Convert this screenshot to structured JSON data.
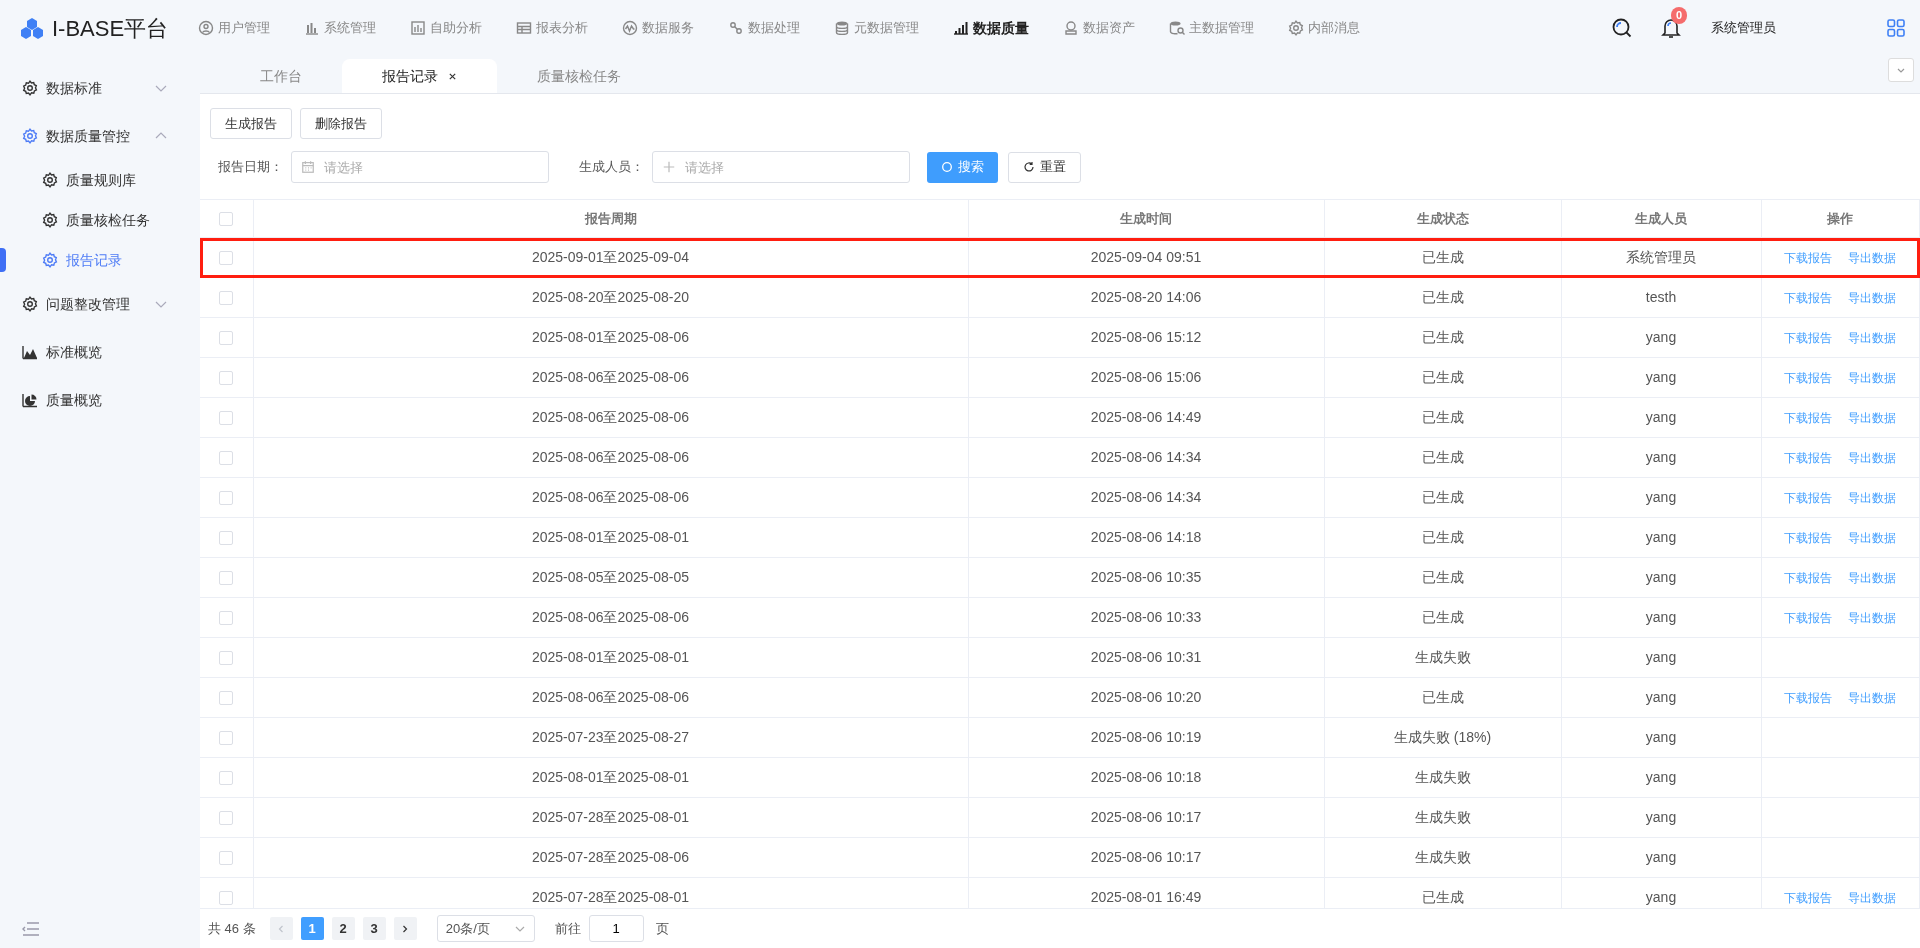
{
  "brand": {
    "title": "I-BASE平台"
  },
  "nav": [
    {
      "label": "用户管理",
      "selected": false
    },
    {
      "label": "系统管理",
      "selected": false
    },
    {
      "label": "自助分析",
      "selected": false
    },
    {
      "label": "报表分析",
      "selected": false
    },
    {
      "label": "数据服务",
      "selected": false
    },
    {
      "label": "数据处理",
      "selected": false
    },
    {
      "label": "元数据管理",
      "selected": false
    },
    {
      "label": "数据质量",
      "selected": true
    },
    {
      "label": "数据资产",
      "selected": false
    },
    {
      "label": "主数据管理",
      "selected": false
    },
    {
      "label": "内部消息",
      "selected": false
    }
  ],
  "header_right": {
    "notification_count": "0",
    "user": "系统管理员"
  },
  "tabs": [
    {
      "label": "工作台",
      "selected": false,
      "closable": false
    },
    {
      "label": "报告记录",
      "selected": true,
      "closable": true
    },
    {
      "label": "质量核检任务",
      "selected": false,
      "closable": false
    }
  ],
  "sidebar": {
    "items": [
      {
        "label": "数据标准",
        "expanded": false,
        "selected": false
      },
      {
        "label": "数据质量管控",
        "expanded": true,
        "selected": false,
        "children": [
          {
            "label": "质量规则库",
            "selected": false
          },
          {
            "label": "质量核检任务",
            "selected": false
          },
          {
            "label": "报告记录",
            "selected": true
          }
        ]
      },
      {
        "label": "问题整改管理",
        "expanded": false,
        "selected": false
      },
      {
        "label": "标准概览",
        "selected": false
      },
      {
        "label": "质量概览",
        "selected": false
      }
    ]
  },
  "toolbar": [
    "生成报告",
    "删除报告"
  ],
  "filters": [
    {
      "label": "报告日期：",
      "placeholder": "请选择"
    },
    {
      "label": "生成人员：",
      "placeholder": "请选择"
    }
  ],
  "search_button": "搜索",
  "reset_button": "重置",
  "table": {
    "select_all_checked": false,
    "columns": [
      "报告周期",
      "生成时间",
      "生成状态",
      "生成人员",
      "操作"
    ],
    "rows": [
      {
        "checked": false,
        "highlighted": true,
        "period": "2025-09-01至2025-09-04",
        "time": "2025-09-04 09:51",
        "status": "已生成",
        "user": "系统管理员",
        "actions": [
          "下载报告",
          "导出数据"
        ]
      },
      {
        "checked": false,
        "highlighted": false,
        "period": "2025-08-20至2025-08-20",
        "time": "2025-08-20 14:06",
        "status": "已生成",
        "user": "testh",
        "actions": [
          "下载报告",
          "导出数据"
        ]
      },
      {
        "checked": false,
        "highlighted": false,
        "period": "2025-08-01至2025-08-06",
        "time": "2025-08-06 15:12",
        "status": "已生成",
        "user": "yang",
        "actions": [
          "下载报告",
          "导出数据"
        ]
      },
      {
        "checked": false,
        "highlighted": false,
        "period": "2025-08-06至2025-08-06",
        "time": "2025-08-06 15:06",
        "status": "已生成",
        "user": "yang",
        "actions": [
          "下载报告",
          "导出数据"
        ]
      },
      {
        "checked": false,
        "highlighted": false,
        "period": "2025-08-06至2025-08-06",
        "time": "2025-08-06 14:49",
        "status": "已生成",
        "user": "yang",
        "actions": [
          "下载报告",
          "导出数据"
        ]
      },
      {
        "checked": false,
        "highlighted": false,
        "period": "2025-08-06至2025-08-06",
        "time": "2025-08-06 14:34",
        "status": "已生成",
        "user": "yang",
        "actions": [
          "下载报告",
          "导出数据"
        ]
      },
      {
        "checked": false,
        "highlighted": false,
        "period": "2025-08-06至2025-08-06",
        "time": "2025-08-06 14:34",
        "status": "已生成",
        "user": "yang",
        "actions": [
          "下载报告",
          "导出数据"
        ]
      },
      {
        "checked": false,
        "highlighted": false,
        "period": "2025-08-01至2025-08-01",
        "time": "2025-08-06 14:18",
        "status": "已生成",
        "user": "yang",
        "actions": [
          "下载报告",
          "导出数据"
        ]
      },
      {
        "checked": false,
        "highlighted": false,
        "period": "2025-08-05至2025-08-05",
        "time": "2025-08-06 10:35",
        "status": "已生成",
        "user": "yang",
        "actions": [
          "下载报告",
          "导出数据"
        ]
      },
      {
        "checked": false,
        "highlighted": false,
        "period": "2025-08-06至2025-08-06",
        "time": "2025-08-06 10:33",
        "status": "已生成",
        "user": "yang",
        "actions": [
          "下载报告",
          "导出数据"
        ]
      },
      {
        "checked": false,
        "highlighted": false,
        "period": "2025-08-01至2025-08-01",
        "time": "2025-08-06 10:31",
        "status": "生成失败",
        "user": "yang"
      },
      {
        "checked": false,
        "highlighted": false,
        "period": "2025-08-06至2025-08-06",
        "time": "2025-08-06 10:20",
        "status": "已生成",
        "user": "yang",
        "actions": [
          "下载报告",
          "导出数据"
        ]
      },
      {
        "checked": false,
        "highlighted": false,
        "period": "2025-07-23至2025-08-27",
        "time": "2025-08-06 10:19",
        "status": "生成失败 (18%)",
        "user": "yang"
      },
      {
        "checked": false,
        "highlighted": false,
        "period": "2025-08-01至2025-08-01",
        "time": "2025-08-06 10:18",
        "status": "生成失败",
        "user": "yang"
      },
      {
        "checked": false,
        "highlighted": false,
        "period": "2025-07-28至2025-08-01",
        "time": "2025-08-06 10:17",
        "status": "生成失败",
        "user": "yang"
      },
      {
        "checked": false,
        "highlighted": false,
        "period": "2025-07-28至2025-08-06",
        "time": "2025-08-06 10:17",
        "status": "生成失败",
        "user": "yang"
      },
      {
        "checked": false,
        "highlighted": false,
        "period": "2025-07-28至2025-08-01",
        "time": "2025-08-01 16:49",
        "status": "已生成",
        "user": "yang",
        "actions": [
          "下载报告",
          "导出数据"
        ]
      }
    ]
  },
  "pagination": {
    "total": "共 46 条",
    "pages": [
      {
        "label": "1",
        "selected": true
      },
      {
        "label": "2",
        "selected": false
      },
      {
        "label": "3",
        "selected": false
      }
    ],
    "prev_disabled": true,
    "next_disabled": false,
    "page_size": "20条/页",
    "goto_label": "前往",
    "goto_value": "1",
    "goto_suffix": "页"
  }
}
